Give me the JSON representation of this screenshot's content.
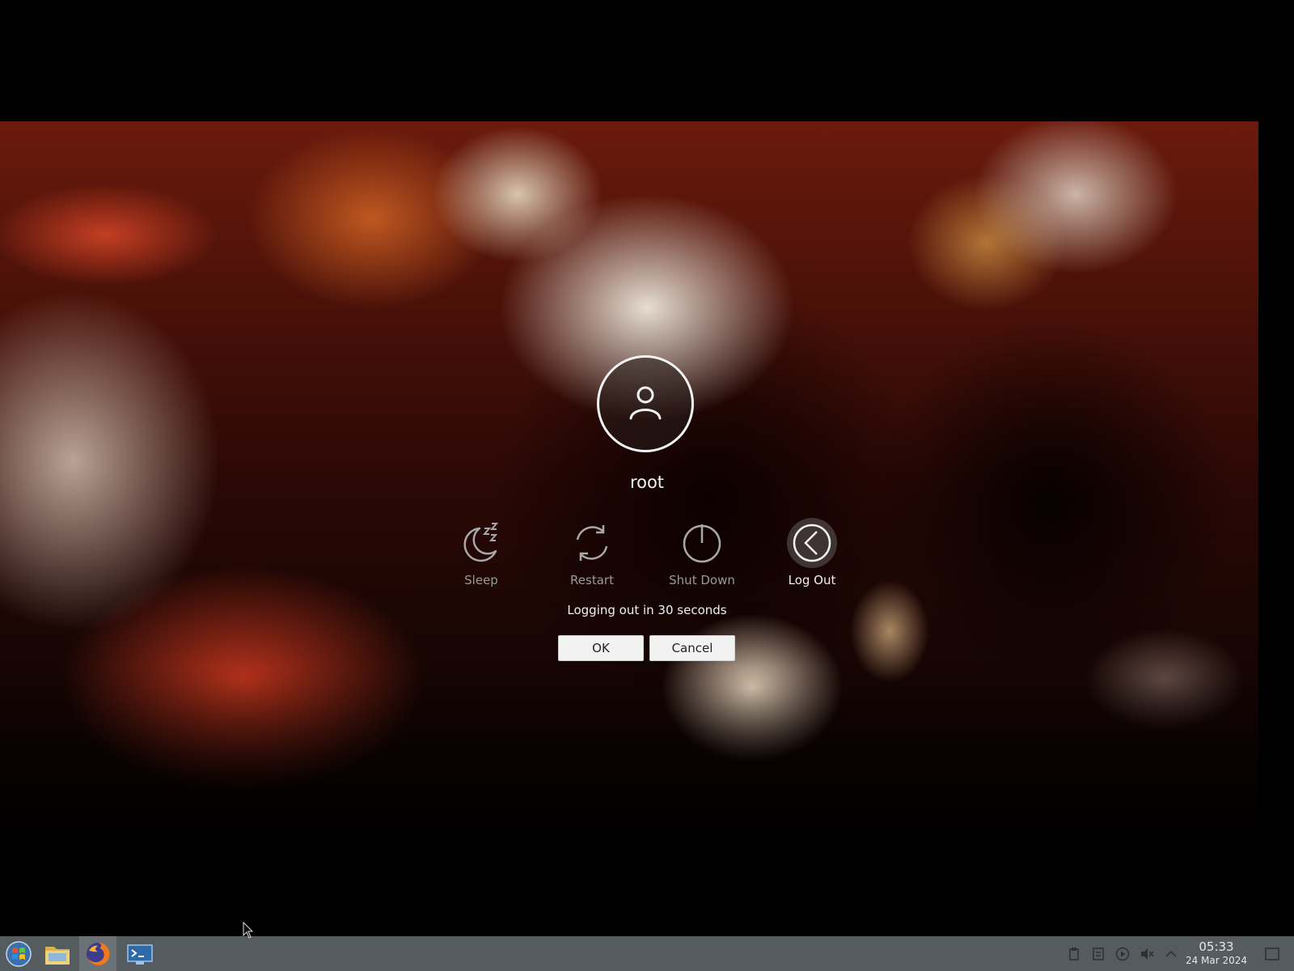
{
  "logout_screen": {
    "username": "root",
    "actions": [
      {
        "label": "Sleep",
        "icon": "sleep-icon"
      },
      {
        "label": "Restart",
        "icon": "restart-icon"
      },
      {
        "label": "Shut Down",
        "icon": "power-icon"
      },
      {
        "label": "Log Out",
        "icon": "logout-icon",
        "selected": true
      }
    ],
    "countdown": "Logging out in 30 seconds",
    "ok_label": "OK",
    "cancel_label": "Cancel"
  },
  "taskbar": {
    "launchers": [
      {
        "icon": "start-menu-icon"
      },
      {
        "icon": "file-manager-icon"
      },
      {
        "icon": "firefox-icon",
        "active": true
      },
      {
        "icon": "terminal-app-icon"
      }
    ],
    "tray": [
      "clipboard-icon",
      "notes-icon",
      "media-play-icon",
      "volume-muted-icon",
      "expand-tray-icon"
    ],
    "clock": {
      "time": "05:33",
      "date": "24 Mar 2024"
    }
  },
  "colors": {
    "taskbar_bg": "#545c60",
    "dialog_text": "#f0f0f0",
    "inactive_text": "#9a9a9a"
  }
}
